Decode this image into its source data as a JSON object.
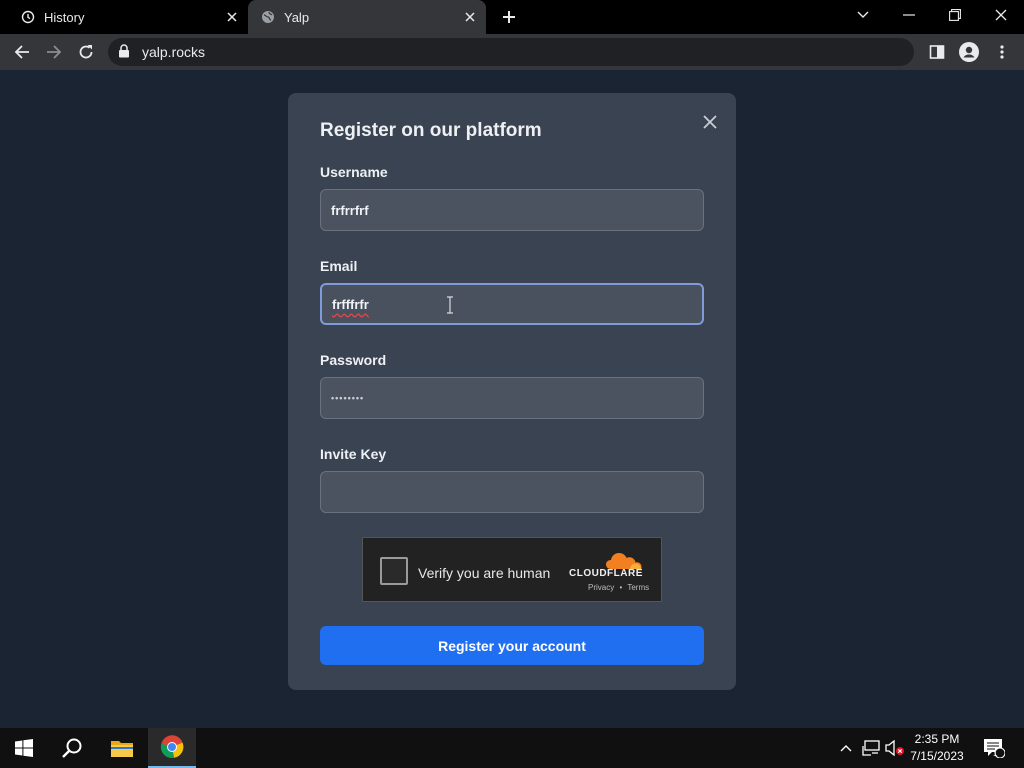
{
  "browser": {
    "tabs": [
      {
        "title": "History",
        "icon": "history-icon"
      },
      {
        "title": "Yalp",
        "icon": "globe-icon"
      }
    ],
    "url": "yalp.rocks"
  },
  "modal": {
    "title": "Register on our platform",
    "fields": [
      {
        "label": "Username",
        "value": "frfrrfrf"
      },
      {
        "label": "Email",
        "value": "frfffrfr"
      },
      {
        "label": "Password",
        "value": "••••••••"
      },
      {
        "label": "Invite Key",
        "value": ""
      }
    ],
    "captcha": {
      "text": "Verify you are human",
      "brand": "CLOUDFLARE",
      "privacy": "Privacy",
      "separator": "•",
      "terms": "Terms"
    },
    "submit_label": "Register your account"
  },
  "taskbar": {
    "time": "2:35 PM",
    "date": "7/15/2023",
    "notification_count": "1"
  },
  "colors": {
    "page_bg": "#1b2432",
    "modal_bg": "#3a4352",
    "primary_button": "#1f6ff0",
    "cloudflare_orange": "#f38020"
  }
}
